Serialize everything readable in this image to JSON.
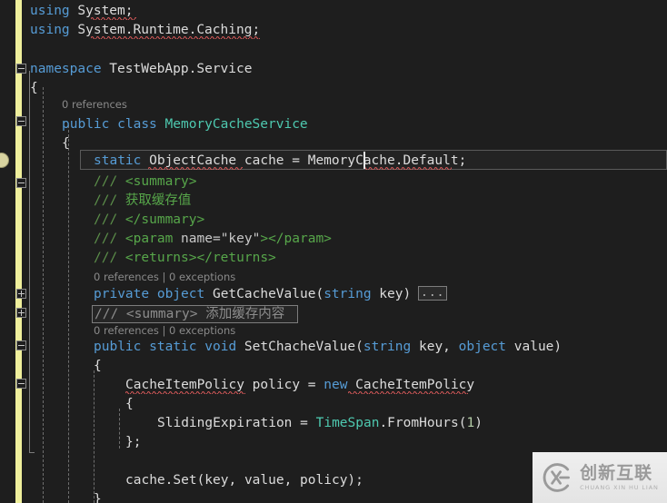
{
  "editor": {
    "language": "csharp",
    "theme": "dark",
    "background_color": "#1e1e1e",
    "change_bar_color": "#efef9c",
    "current_line_color": "#232323",
    "keyword_color": "#569cd6",
    "type_color": "#4ec9b0",
    "comment_color": "#57a64a",
    "text_color": "#dcdcdc",
    "error_squiggle_color": "#e05c5c"
  },
  "lines": [
    {
      "n": 1,
      "indent": 1,
      "tokens": [
        {
          "t": "using",
          "c": "kw"
        },
        {
          "t": " System;",
          "c": "id"
        }
      ]
    },
    {
      "n": 2,
      "indent": 1,
      "tokens": [
        {
          "t": "using",
          "c": "kw"
        },
        {
          "t": " System.Runtime.Caching;",
          "c": "id"
        }
      ]
    },
    {
      "n": 3,
      "indent": 1,
      "tokens": []
    },
    {
      "n": 4,
      "indent": 1,
      "tokens": [
        {
          "t": "namespace",
          "c": "kw"
        },
        {
          "t": " TestWebApp.Service",
          "c": "id"
        }
      ]
    },
    {
      "n": 5,
      "indent": 1,
      "tokens": [
        {
          "t": "{",
          "c": "punc"
        }
      ]
    },
    {
      "n": 6,
      "indent": 2,
      "tokens": [
        {
          "t": "public",
          "c": "kw"
        },
        {
          "t": " ",
          "c": "id"
        },
        {
          "t": "class",
          "c": "kw"
        },
        {
          "t": " ",
          "c": "id"
        },
        {
          "t": "MemoryCacheService",
          "c": "typ"
        }
      ]
    },
    {
      "n": 7,
      "indent": 2,
      "tokens": [
        {
          "t": "{",
          "c": "punc"
        }
      ]
    },
    {
      "n": 8,
      "indent": 3,
      "tokens": [
        {
          "t": "static",
          "c": "kw"
        },
        {
          "t": " ",
          "c": "id"
        },
        {
          "t": "ObjectCache",
          "c": "id"
        },
        {
          "t": " cache = MemoryCache.Default;",
          "c": "id"
        }
      ]
    },
    {
      "n": 9,
      "indent": 3,
      "tokens": [
        {
          "t": "/// ",
          "c": "cmt-dim"
        },
        {
          "t": "<summary>",
          "c": "cmt"
        }
      ]
    },
    {
      "n": 10,
      "indent": 3,
      "tokens": [
        {
          "t": "/// ",
          "c": "cmt-dim"
        },
        {
          "t": "获取缓存值",
          "c": "cmt"
        }
      ]
    },
    {
      "n": 11,
      "indent": 3,
      "tokens": [
        {
          "t": "/// ",
          "c": "cmt-dim"
        },
        {
          "t": "</summary>",
          "c": "cmt"
        }
      ]
    },
    {
      "n": 12,
      "indent": 3,
      "tokens": [
        {
          "t": "/// ",
          "c": "cmt-dim"
        },
        {
          "t": "<param ",
          "c": "cmt"
        },
        {
          "t": "name=",
          "c": "doc-name"
        },
        {
          "t": "\"key\"",
          "c": "doc-val"
        },
        {
          "t": ">",
          "c": "cmt"
        },
        {
          "t": "</param>",
          "c": "cmt"
        }
      ]
    },
    {
      "n": 13,
      "indent": 3,
      "tokens": [
        {
          "t": "/// ",
          "c": "cmt-dim"
        },
        {
          "t": "<returns></returns>",
          "c": "cmt"
        }
      ]
    },
    {
      "n": 14,
      "indent": 3,
      "tokens": [
        {
          "t": "private",
          "c": "kw"
        },
        {
          "t": " ",
          "c": "id"
        },
        {
          "t": "object",
          "c": "kw"
        },
        {
          "t": " GetCacheValue(",
          "c": "id"
        },
        {
          "t": "string",
          "c": "kw"
        },
        {
          "t": " key)",
          "c": "id"
        }
      ]
    },
    {
      "n": 15,
      "indent": 3,
      "tokens": []
    },
    {
      "n": 16,
      "indent": 3,
      "tokens": [
        {
          "t": "public",
          "c": "kw"
        },
        {
          "t": " ",
          "c": "id"
        },
        {
          "t": "static",
          "c": "kw"
        },
        {
          "t": " ",
          "c": "id"
        },
        {
          "t": "void",
          "c": "kw"
        },
        {
          "t": " SetChacheValue(",
          "c": "id"
        },
        {
          "t": "string",
          "c": "kw"
        },
        {
          "t": " key, ",
          "c": "id"
        },
        {
          "t": "object",
          "c": "kw"
        },
        {
          "t": " value)",
          "c": "id"
        }
      ]
    },
    {
      "n": 17,
      "indent": 3,
      "tokens": [
        {
          "t": "{",
          "c": "punc"
        }
      ]
    },
    {
      "n": 18,
      "indent": 4,
      "tokens": [
        {
          "t": "CacheItemPolicy",
          "c": "id"
        },
        {
          "t": " policy = ",
          "c": "id"
        },
        {
          "t": "new",
          "c": "kw"
        },
        {
          "t": " ",
          "c": "id"
        },
        {
          "t": "CacheItemPolicy",
          "c": "id"
        }
      ]
    },
    {
      "n": 19,
      "indent": 4,
      "tokens": [
        {
          "t": "{",
          "c": "punc"
        }
      ]
    },
    {
      "n": 20,
      "indent": 5,
      "tokens": [
        {
          "t": "SlidingExpiration = ",
          "c": "id"
        },
        {
          "t": "TimeSpan",
          "c": "typ"
        },
        {
          "t": ".FromHours(",
          "c": "id"
        },
        {
          "t": "1",
          "c": "num"
        },
        {
          "t": ")",
          "c": "id"
        }
      ]
    },
    {
      "n": 21,
      "indent": 4,
      "tokens": [
        {
          "t": "};",
          "c": "punc"
        }
      ]
    },
    {
      "n": 22,
      "indent": 4,
      "tokens": []
    },
    {
      "n": 23,
      "indent": 4,
      "tokens": [
        {
          "t": "cache.Set(key, value, policy);",
          "c": "id"
        }
      ]
    },
    {
      "n": 24,
      "indent": 4,
      "tokens": [
        {
          "t": "}",
          "c": "punc"
        }
      ]
    }
  ],
  "codelens": [
    {
      "id": "class-lens",
      "text": "0 references"
    },
    {
      "id": "getcachevalue-lens",
      "text": "0 references | 0 exceptions"
    },
    {
      "id": "setchachevalue-lens",
      "text": "0 references | 0 exceptions"
    }
  ],
  "collapsed": {
    "getcachevalue_body": "...",
    "summary_region_prefix": "/// ",
    "summary_region_tag": "<summary>",
    "summary_region_text": " 添加缓存内容"
  },
  "fold_markers": [
    {
      "id": "namespace-fold",
      "state": "expanded"
    },
    {
      "id": "class-fold",
      "state": "expanded"
    },
    {
      "id": "docblock-fold",
      "state": "expanded"
    },
    {
      "id": "method1-fold",
      "state": "collapsed"
    },
    {
      "id": "docblock2-fold",
      "state": "collapsed"
    },
    {
      "id": "method2-fold",
      "state": "expanded"
    },
    {
      "id": "initializer-fold",
      "state": "expanded"
    }
  ],
  "errors": [
    {
      "id": "using-system-error",
      "target": "System;"
    },
    {
      "id": "using-caching-error",
      "target": "System.Runtime.Caching;"
    },
    {
      "id": "objectcache-error",
      "target": "ObjectCache"
    },
    {
      "id": "memorycache-error",
      "target": "MemoryCache"
    },
    {
      "id": "cacheitempolicy-error1",
      "target": "CacheItemPolicy"
    },
    {
      "id": "cacheitempolicy-error2",
      "target": "CacheItemPolicy"
    }
  ],
  "watermark": {
    "logo_letters": "CX",
    "title_cn": "创新互联",
    "title_en": "CHUANG XIN HU LIAN"
  }
}
